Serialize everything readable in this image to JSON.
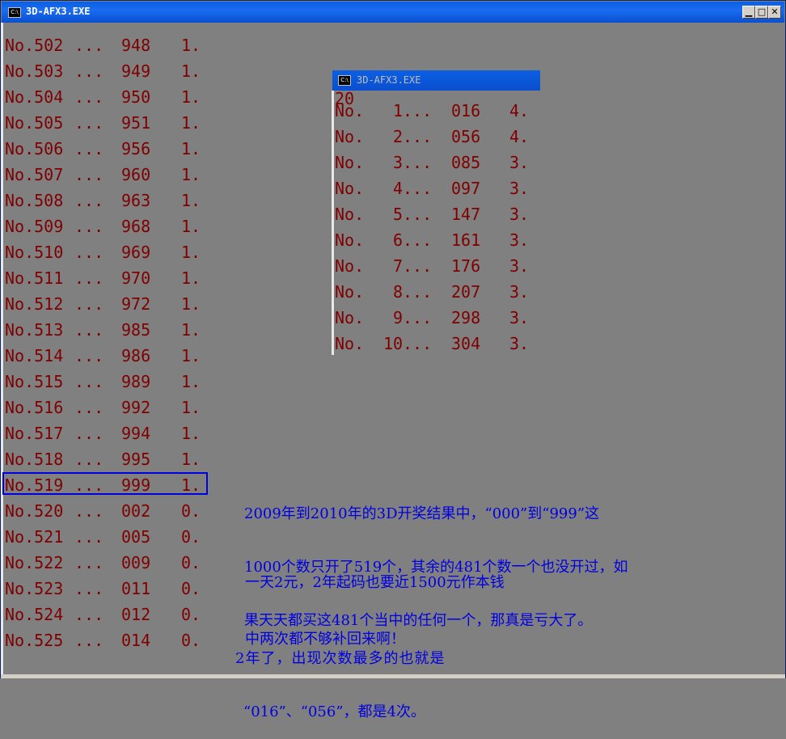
{
  "window": {
    "title": "3D-AFX3.EXE",
    "icon": "C:\\"
  },
  "rows": [
    {
      "no": "No.502",
      "dots": "...",
      "value": "948",
      "count": "1."
    },
    {
      "no": "No.503",
      "dots": "...",
      "value": "949",
      "count": "1."
    },
    {
      "no": "No.504",
      "dots": "...",
      "value": "950",
      "count": "1."
    },
    {
      "no": "No.505",
      "dots": "...",
      "value": "951",
      "count": "1."
    },
    {
      "no": "No.506",
      "dots": "...",
      "value": "956",
      "count": "1."
    },
    {
      "no": "No.507",
      "dots": "...",
      "value": "960",
      "count": "1."
    },
    {
      "no": "No.508",
      "dots": "...",
      "value": "963",
      "count": "1."
    },
    {
      "no": "No.509",
      "dots": "...",
      "value": "968",
      "count": "1."
    },
    {
      "no": "No.510",
      "dots": "...",
      "value": "969",
      "count": "1."
    },
    {
      "no": "No.511",
      "dots": "...",
      "value": "970",
      "count": "1."
    },
    {
      "no": "No.512",
      "dots": "...",
      "value": "972",
      "count": "1."
    },
    {
      "no": "No.513",
      "dots": "...",
      "value": "985",
      "count": "1."
    },
    {
      "no": "No.514",
      "dots": "...",
      "value": "986",
      "count": "1."
    },
    {
      "no": "No.515",
      "dots": "...",
      "value": "989",
      "count": "1."
    },
    {
      "no": "No.516",
      "dots": "...",
      "value": "992",
      "count": "1."
    },
    {
      "no": "No.517",
      "dots": "...",
      "value": "994",
      "count": "1."
    },
    {
      "no": "No.518",
      "dots": "...",
      "value": "995",
      "count": "1."
    },
    {
      "no": "No.519",
      "dots": "...",
      "value": "999",
      "count": "1."
    },
    {
      "no": "No.520",
      "dots": "...",
      "value": "002",
      "count": "0."
    },
    {
      "no": "No.521",
      "dots": "...",
      "value": "005",
      "count": "0."
    },
    {
      "no": "No.522",
      "dots": "...",
      "value": "009",
      "count": "0."
    },
    {
      "no": "No.523",
      "dots": "...",
      "value": "011",
      "count": "0."
    },
    {
      "no": "No.524",
      "dots": "...",
      "value": "012",
      "count": "0."
    },
    {
      "no": "No.525",
      "dots": "...",
      "value": "014",
      "count": "0."
    }
  ],
  "inner_window": {
    "title": "3D-AFX3.EXE",
    "icon": "C:\\",
    "header": "20",
    "rows": [
      {
        "no": "No.",
        "idx": "1",
        "dots": "...",
        "value": "016",
        "count": "4."
      },
      {
        "no": "No.",
        "idx": "2",
        "dots": "...",
        "value": "056",
        "count": "4."
      },
      {
        "no": "No.",
        "idx": "3",
        "dots": "...",
        "value": "085",
        "count": "3."
      },
      {
        "no": "No.",
        "idx": "4",
        "dots": "...",
        "value": "097",
        "count": "3."
      },
      {
        "no": "No.",
        "idx": "5",
        "dots": "...",
        "value": "147",
        "count": "3."
      },
      {
        "no": "No.",
        "idx": "6",
        "dots": "...",
        "value": "161",
        "count": "3."
      },
      {
        "no": "No.",
        "idx": "7",
        "dots": "...",
        "value": "176",
        "count": "3."
      },
      {
        "no": "No.",
        "idx": "8",
        "dots": "...",
        "value": "207",
        "count": "3."
      },
      {
        "no": "No.",
        "idx": "9",
        "dots": "...",
        "value": "298",
        "count": "3."
      },
      {
        "no": "No.",
        "idx": "10",
        "dots": "...",
        "value": "304",
        "count": "3."
      }
    ]
  },
  "annotations": {
    "note1": [
      "2009年到2010年的3D开奖结果中，“000”到“999”这",
      "1000个数只开了519个，其余的481个数一个也没开过，如",
      "果天天都买这481个当中的任何一个，那真是亏大了。"
    ],
    "note2": [
      "一天2元，2年起码也要近1500元作本钱",
      "中两次都不够补回来啊！"
    ],
    "note3": [
      "2年了，出现次数最多的也就是",
      "“016”、“056”，都是4次。"
    ]
  },
  "colors": {
    "text": "#800000",
    "note": "#0000e0",
    "background": "#808080",
    "titlebar": "#0a5fe0"
  }
}
